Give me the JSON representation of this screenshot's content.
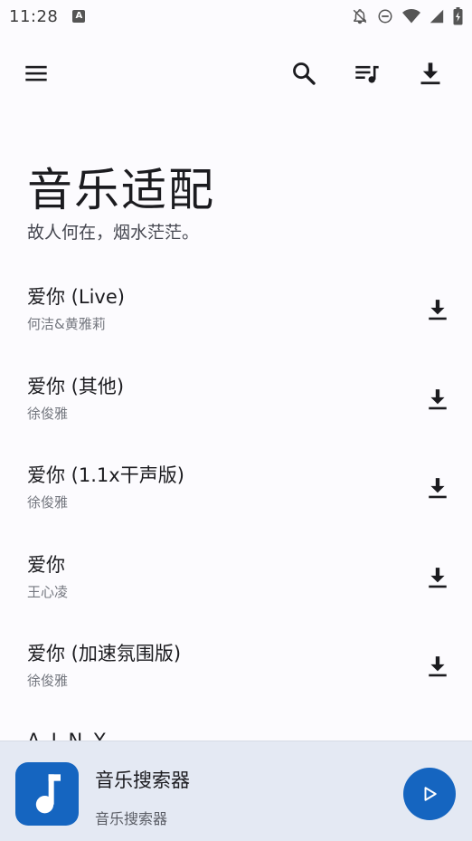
{
  "status_bar": {
    "time": "11:28",
    "notification_letter": "A"
  },
  "toolbar": {
    "menu_icon": "menu-icon",
    "search_icon": "search-icon",
    "playlist_icon": "queue-music-icon",
    "download_icon": "download-icon"
  },
  "page": {
    "title": "音乐适配",
    "subtitle": "故人何在，烟水茫茫。"
  },
  "songs": [
    {
      "title": "爱你 (Live)",
      "artist": "何洁&黄雅莉"
    },
    {
      "title": "爱你 (其他)",
      "artist": "徐俊雅"
    },
    {
      "title": "爱你 (1.1x干声版)",
      "artist": "徐俊雅"
    },
    {
      "title": "爱你",
      "artist": "王心凌"
    },
    {
      "title": "爱你 (加速氛围版)",
      "artist": "徐俊雅"
    }
  ],
  "partial_item": "A.I.N.Y",
  "player": {
    "title": "音乐搜索器",
    "subtitle": "音乐搜索器",
    "accent": "#1565c0"
  }
}
